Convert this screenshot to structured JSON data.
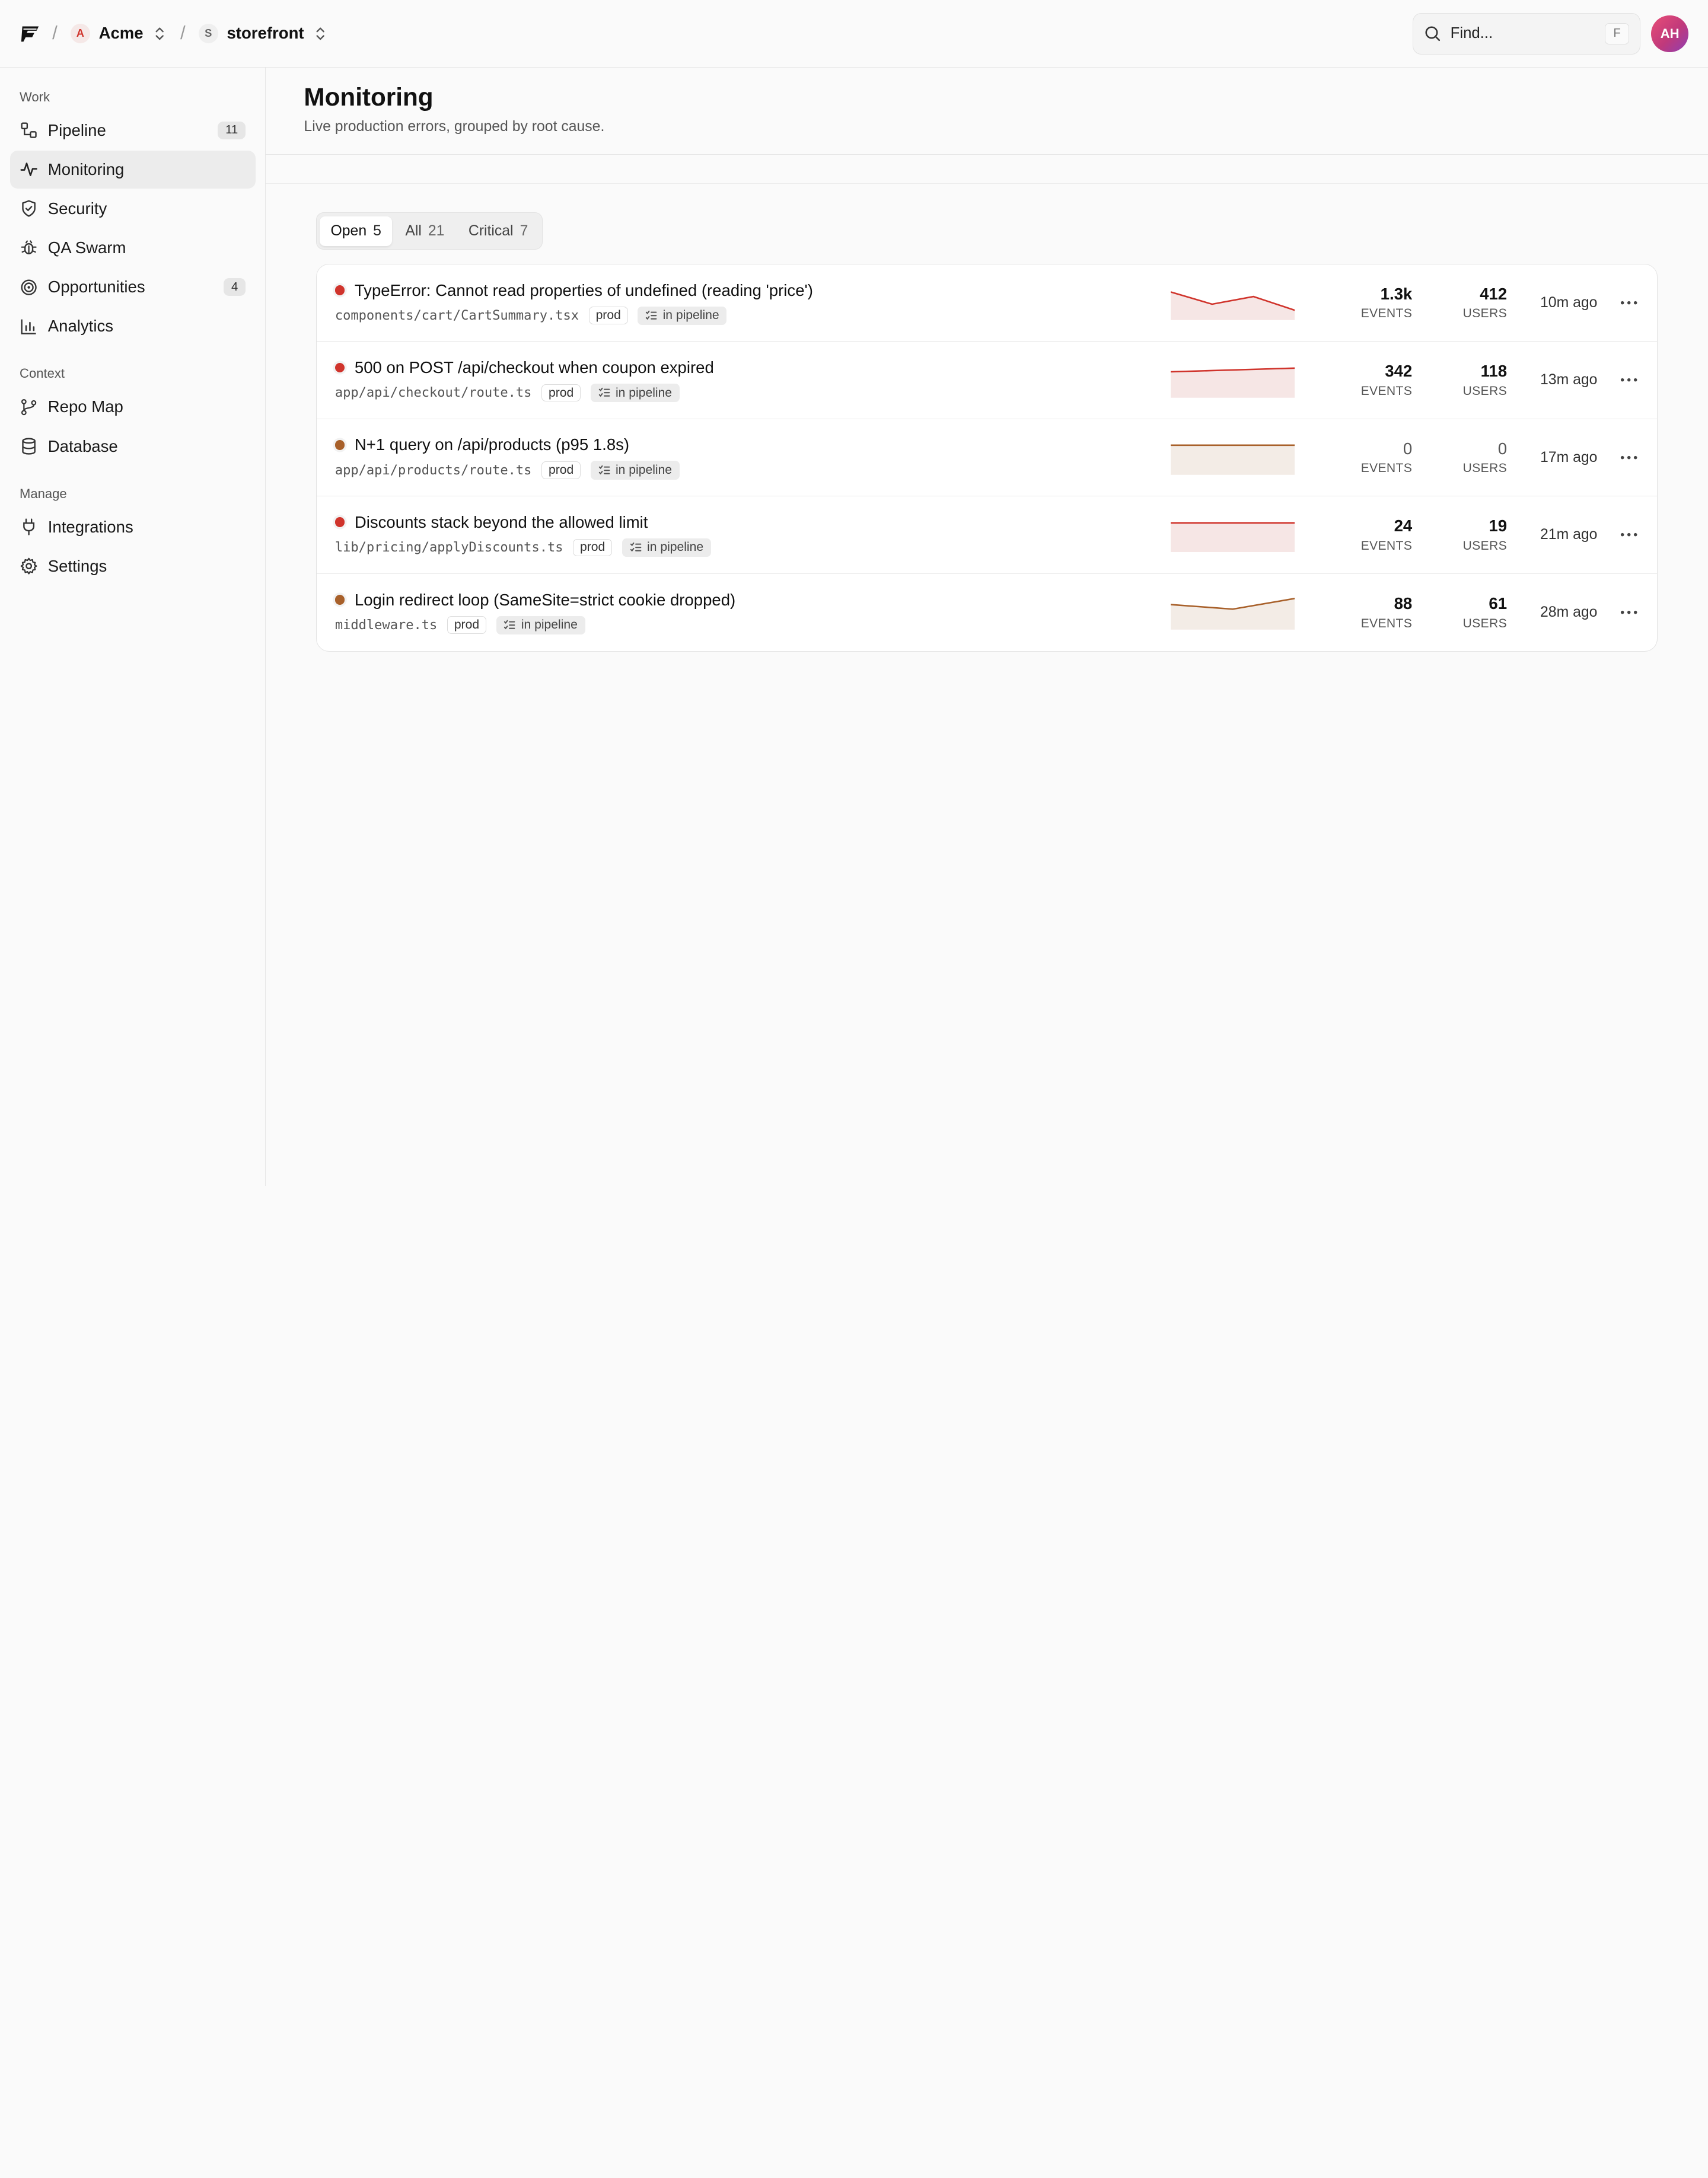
{
  "topbar": {
    "org": {
      "initial": "A",
      "name": "Acme"
    },
    "repo": {
      "initial": "S",
      "name": "storefront"
    },
    "search": {
      "placeholder": "Find...",
      "shortcut": "F"
    },
    "user_initials": "AH"
  },
  "sidebar": {
    "sections": [
      {
        "label": "Work",
        "items": [
          {
            "label": "Pipeline",
            "icon": "pipeline-icon",
            "count": "11"
          },
          {
            "label": "Monitoring",
            "icon": "activity-icon",
            "active": true
          },
          {
            "label": "Security",
            "icon": "shield-icon"
          },
          {
            "label": "QA Swarm",
            "icon": "bug-icon"
          },
          {
            "label": "Opportunities",
            "icon": "target-icon",
            "count": "4"
          },
          {
            "label": "Analytics",
            "icon": "bar-chart-icon"
          }
        ]
      },
      {
        "label": "Context",
        "items": [
          {
            "label": "Repo Map",
            "icon": "git-branch-icon"
          },
          {
            "label": "Database",
            "icon": "database-icon"
          }
        ]
      },
      {
        "label": "Manage",
        "items": [
          {
            "label": "Integrations",
            "icon": "plug-icon"
          },
          {
            "label": "Settings",
            "icon": "gear-icon"
          }
        ]
      }
    ]
  },
  "page": {
    "title": "Monitoring",
    "subtitle": "Live production errors, grouped by root cause."
  },
  "tabs": [
    {
      "label": "Open",
      "count": "5",
      "active": true
    },
    {
      "label": "All",
      "count": "21"
    },
    {
      "label": "Critical",
      "count": "7"
    }
  ],
  "colors": {
    "critical": "#d0342c",
    "warning": "#a8602a",
    "critical_fill": "#f6e6e5",
    "warning_fill": "#f3ece6"
  },
  "issues": [
    {
      "title": "TypeError: Cannot read properties of undefined (reading 'price')",
      "path": "components/cart/CartSummary.tsx",
      "env": "prod",
      "status": "in pipeline",
      "severity": "critical",
      "events": "1.3k",
      "users": "412",
      "time": "10m ago",
      "trend": [
        0.85,
        0.45,
        0.7,
        0.25
      ]
    },
    {
      "title": "500 on POST /api/checkout when coupon expired",
      "path": "app/api/checkout/route.ts",
      "env": "prod",
      "status": "in pipeline",
      "severity": "critical",
      "events": "342",
      "users": "118",
      "time": "13m ago",
      "trend": [
        0.78,
        0.82,
        0.86,
        0.9
      ]
    },
    {
      "title": "N+1 query on /api/products (p95 1.8s)",
      "path": "app/api/products/route.ts",
      "env": "prod",
      "status": "in pipeline",
      "severity": "warning",
      "events": "0",
      "users": "0",
      "time": "17m ago",
      "trend": [
        0.9,
        0.9,
        0.9,
        0.9
      ]
    },
    {
      "title": "Discounts stack beyond the allowed limit",
      "path": "lib/pricing/applyDiscounts.ts",
      "env": "prod",
      "status": "in pipeline",
      "severity": "critical",
      "events": "24",
      "users": "19",
      "time": "21m ago",
      "trend": [
        0.9,
        0.9,
        0.9,
        0.9
      ]
    },
    {
      "title": "Login redirect loop (SameSite=strict cookie dropped)",
      "path": "middleware.ts",
      "env": "prod",
      "status": "in pipeline",
      "severity": "warning",
      "events": "88",
      "users": "61",
      "time": "28m ago",
      "trend": [
        0.75,
        0.6,
        0.95
      ]
    }
  ],
  "labels": {
    "events": "EVENTS",
    "users": "USERS"
  }
}
